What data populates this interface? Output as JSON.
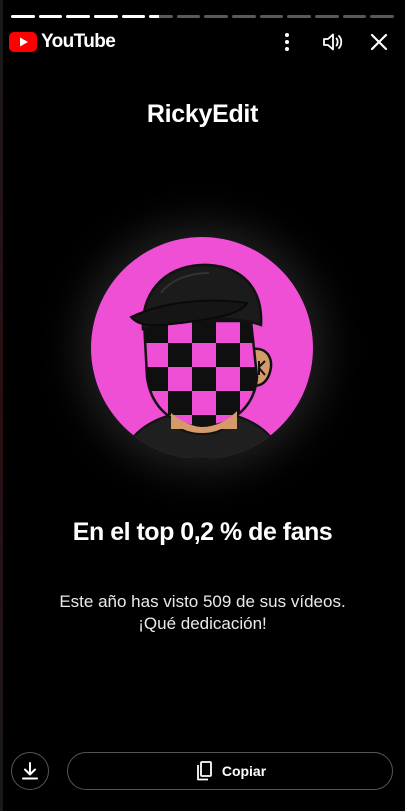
{
  "app": {
    "logo_text": "YouTube",
    "brand_color": "#FF0000"
  },
  "story": {
    "segments_total": 14,
    "segments_complete": 5,
    "current_segment_fraction": 0.4
  },
  "top_actions": {
    "icons": [
      "more-vert-icon",
      "volume-icon",
      "close-icon"
    ]
  },
  "creator": {
    "name": "RickyEdit",
    "avatar_bg_color": "#EE4FD4",
    "avatar_checker_color": "#EE4FD4"
  },
  "stat": {
    "headline": "En el top 0,2 % de fans",
    "line1": "Este año has visto 509 de sus vídeos.",
    "line2": "¡Qué dedicación!"
  },
  "bottom": {
    "download_icon": "download-icon",
    "copy_icon": "copy-icon",
    "copy_label": "Copiar"
  }
}
